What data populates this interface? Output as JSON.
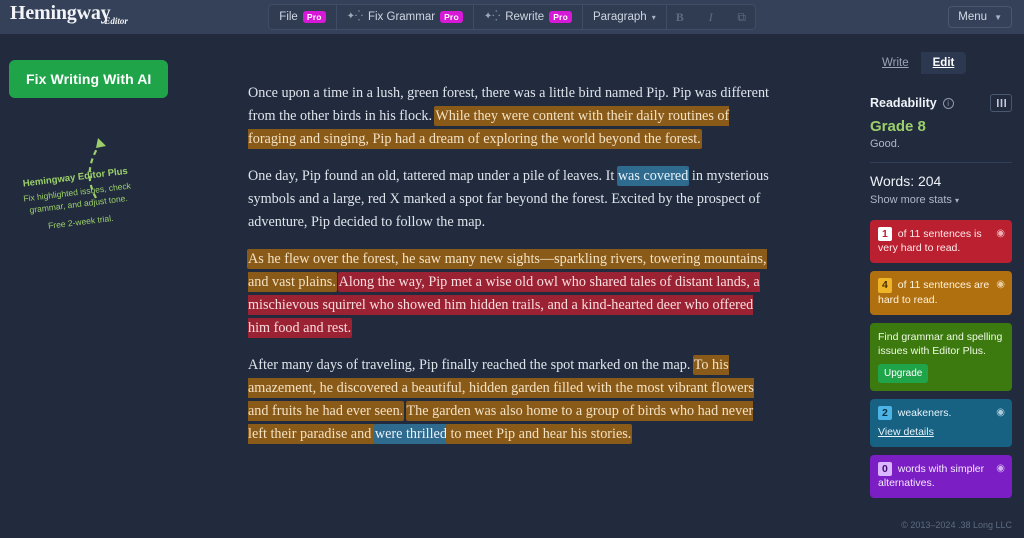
{
  "header": {
    "brand_name": "Hemingway",
    "brand_sub": "Editor",
    "toolbar": {
      "file_label": "File",
      "file_badge": "Pro",
      "fix_grammar_label": "Fix Grammar",
      "fix_grammar_badge": "Pro",
      "rewrite_label": "Rewrite",
      "rewrite_badge": "Pro",
      "paragraph_label": "Paragraph",
      "bold_label": "B",
      "italic_label": "I",
      "link_label": "⧉"
    },
    "menu_label": "Menu"
  },
  "left_sidebar": {
    "ai_button_label": "Fix Writing With AI",
    "promo_title": "Hemingway Editor Plus",
    "promo_line1": "Fix highlighted issues, check",
    "promo_line2": "grammar, and adjust tone.",
    "promo_trial": "Free 2-week trial."
  },
  "editor": {
    "paragraphs": [
      {
        "id": "p1",
        "segments": [
          {
            "text": "Once upon a time in a lush, green forest, there was a little bird named Pip. Pip was different from the other birds in his flock. ",
            "highlight": "none"
          },
          {
            "text": "While they were content with their daily routines of foraging and singing, Pip had a dream of exploring the world beyond the forest.",
            "highlight": "orange"
          }
        ]
      },
      {
        "id": "p2",
        "segments": [
          {
            "text": "One day, Pip found an old, tattered map under a pile of leaves. It ",
            "highlight": "none"
          },
          {
            "text": "was covered",
            "highlight": "blue"
          },
          {
            "text": " in mysterious symbols and a large, red X marked a spot far beyond the forest. Excited by the prospect of adventure, Pip decided to follow the map.",
            "highlight": "none"
          }
        ]
      },
      {
        "id": "p3",
        "segments": [
          {
            "text": "As he flew over the forest, he saw many new sights—sparkling rivers, towering mountains, and vast plains.",
            "highlight": "orange"
          },
          {
            "text": " ",
            "highlight": "none"
          },
          {
            "text": "Along the way, Pip met a wise old owl who shared tales of distant lands, a mischievous squirrel who showed him hidden trails, and a kind-hearted deer who offered him food and rest.",
            "highlight": "red"
          }
        ]
      },
      {
        "id": "p4",
        "segments": [
          {
            "text": "After many days of traveling, Pip finally reached the spot marked on the map. ",
            "highlight": "none"
          },
          {
            "text": "To his amazement, he discovered a beautiful, hidden garden filled with the most vibrant flowers and fruits he had ever seen.",
            "highlight": "orange"
          },
          {
            "text": " ",
            "highlight": "none"
          },
          {
            "text": "The garden was also home to a group of birds who had never left their paradise and ",
            "highlight": "orange"
          },
          {
            "text": "were thrilled",
            "highlight": "blue"
          },
          {
            "text": " to meet Pip and hear his stories.",
            "highlight": "orange"
          }
        ]
      }
    ]
  },
  "right_sidebar": {
    "tab_write": "Write",
    "tab_edit": "Edit",
    "readability_title": "Readability",
    "grade": "Grade 8",
    "grade_note": "Good.",
    "words_label": "Words: 204",
    "show_more_stats": "Show more stats",
    "cards": [
      {
        "type": "very-hard",
        "count": "1",
        "text": " of 11 sentences is very hard to read.",
        "color": "#bb2030"
      },
      {
        "type": "hard",
        "count": "4",
        "text": " of 11 sentences are hard to read.",
        "color": "#b1700f"
      },
      {
        "type": "grammar-upsell",
        "text": "Find grammar and spelling issues with Editor Plus.",
        "button": "Upgrade",
        "color": "#3c7a10"
      },
      {
        "type": "weakeners",
        "count": "2",
        "text": " weakeners.",
        "link": "View details",
        "color": "#176183"
      },
      {
        "type": "simpler",
        "count": "0",
        "text": " words with simpler alternatives.",
        "color": "#7b1fc4"
      }
    ],
    "copyright": "© 2013–2024 .38 Long LLC"
  }
}
